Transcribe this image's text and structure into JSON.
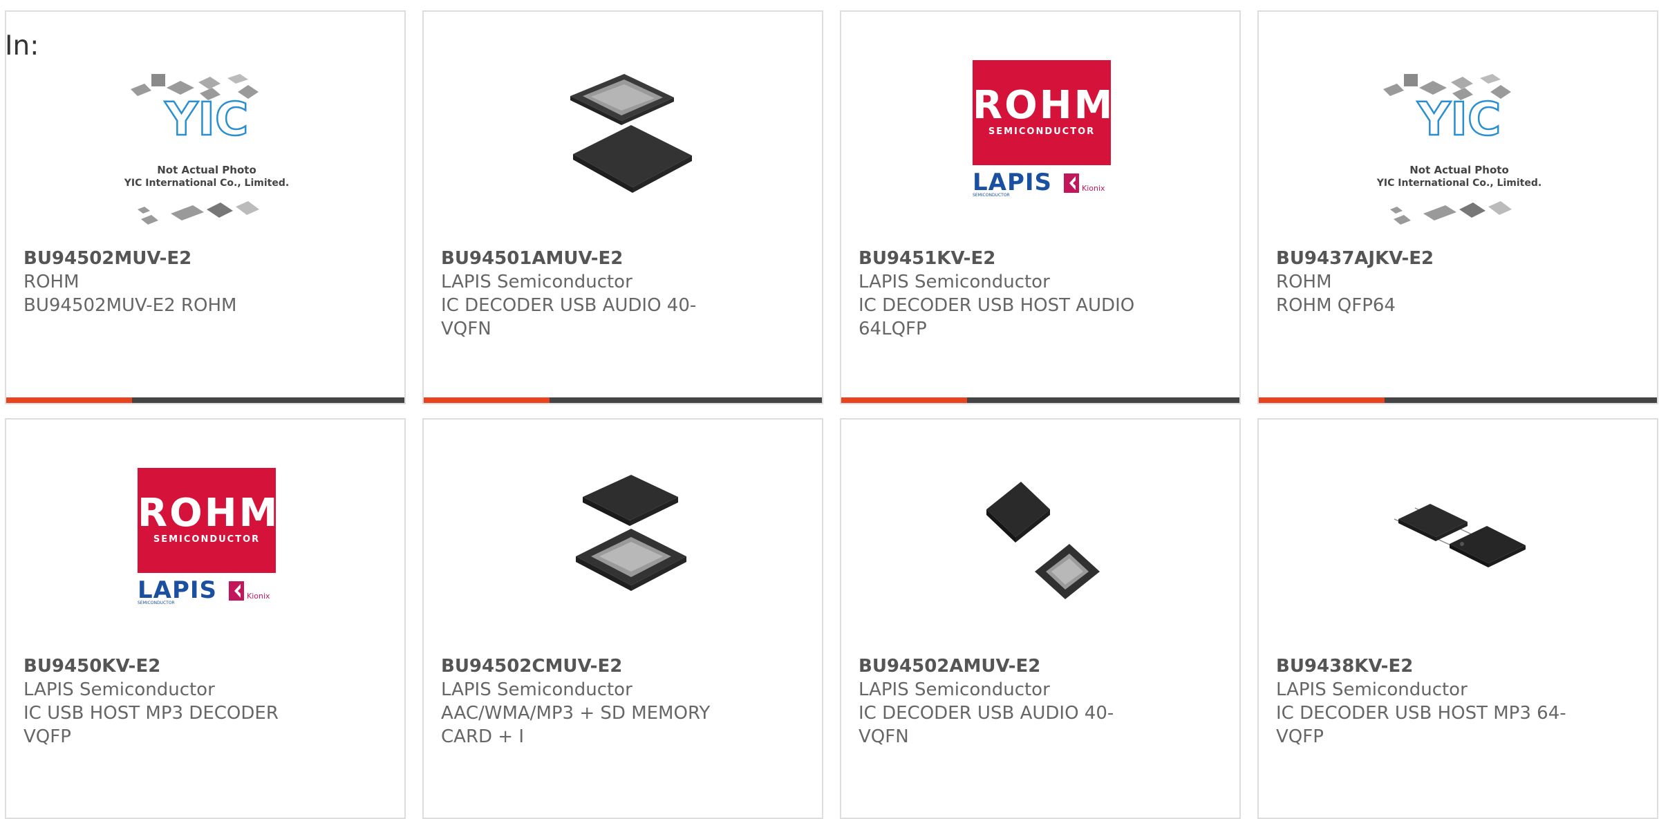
{
  "header": {
    "in_label": "In:"
  },
  "products": [
    {
      "part_number": "BU94502MUV-E2",
      "manufacturer": "ROHM",
      "description": "BU94502MUV-E2 ROHM",
      "image": "yic-placeholder",
      "placeholder_line1": "Not Actual Photo",
      "placeholder_line2": "YIC International Co., Limited."
    },
    {
      "part_number": "BU94501AMUV-E2",
      "manufacturer": "LAPIS Semiconductor",
      "description": "IC DECODER USB AUDIO 40-VQFN",
      "image": "qfn-chip"
    },
    {
      "part_number": "BU9451KV-E2",
      "manufacturer": "LAPIS Semiconductor",
      "description": "IC DECODER USB HOST AUDIO 64LQFP",
      "image": "rohm-logo",
      "logo_text": "ROHM",
      "logo_sub": "SEMICONDUCTOR",
      "lapis_text": "LAPIS",
      "lapis_sub": "SEMICONDUCTOR",
      "kionix_text": "Kionix"
    },
    {
      "part_number": "BU9437AJKV-E2",
      "manufacturer": "ROHM",
      "description": "ROHM QFP64",
      "image": "yic-placeholder",
      "placeholder_line1": "Not Actual Photo",
      "placeholder_line2": "YIC International Co., Limited."
    },
    {
      "part_number": "BU9450KV-E2",
      "manufacturer": "LAPIS Semiconductor",
      "description": "IC USB HOST MP3 DECODER VQFP",
      "image": "rohm-logo",
      "logo_text": "ROHM",
      "logo_sub": "SEMICONDUCTOR",
      "lapis_text": "LAPIS",
      "lapis_sub": "SEMICONDUCTOR",
      "kionix_text": "Kionix"
    },
    {
      "part_number": "BU94502CMUV-E2",
      "manufacturer": "LAPIS Semiconductor",
      "description": "AAC/WMA/MP3 + SD MEMORY CARD + I",
      "image": "qfn-chip"
    },
    {
      "part_number": "BU94502AMUV-E2",
      "manufacturer": "LAPIS Semiconductor",
      "description": "IC DECODER USB AUDIO 40-VQFN",
      "image": "qfn-small-chip"
    },
    {
      "part_number": "BU9438KV-E2",
      "manufacturer": "LAPIS Semiconductor",
      "description": "IC DECODER USB HOST MP3 64-VQFP",
      "image": "qfp-chip"
    }
  ],
  "colors": {
    "accent_bar": "#e8431c",
    "dark_bar": "#444444",
    "rohm_red": "#d4123a",
    "lapis_blue": "#1b4fa0"
  }
}
